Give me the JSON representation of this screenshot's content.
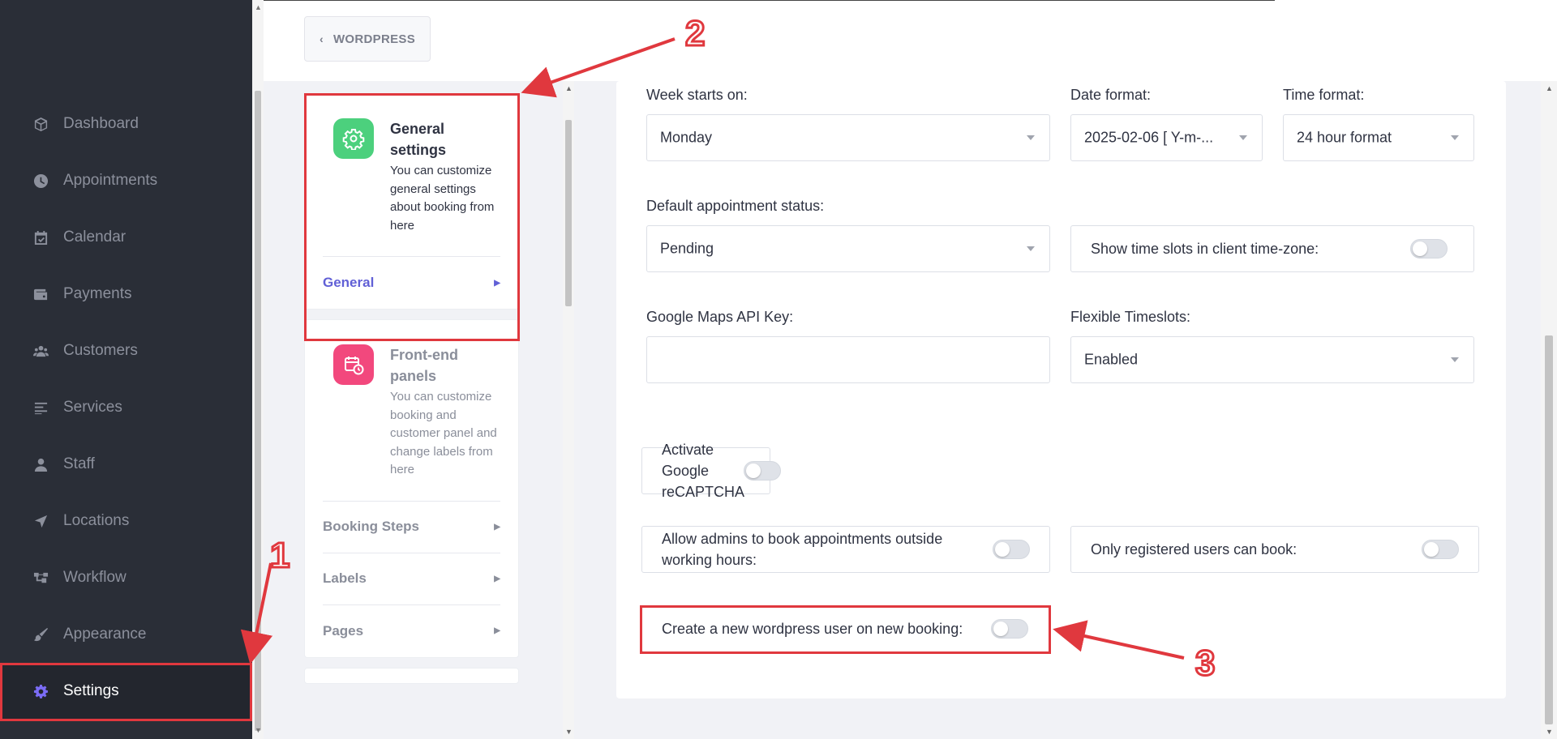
{
  "sidebar": {
    "items": [
      {
        "label": "Dashboard",
        "icon": "cube-icon"
      },
      {
        "label": "Appointments",
        "icon": "clock-icon"
      },
      {
        "label": "Calendar",
        "icon": "calendar-check-icon"
      },
      {
        "label": "Payments",
        "icon": "wallet-icon"
      },
      {
        "label": "Customers",
        "icon": "users-icon"
      },
      {
        "label": "Services",
        "icon": "list-icon"
      },
      {
        "label": "Staff",
        "icon": "user-icon"
      },
      {
        "label": "Locations",
        "icon": "location-arrow-icon"
      },
      {
        "label": "Workflow",
        "icon": "workflow-icon"
      },
      {
        "label": "Appearance",
        "icon": "brush-icon"
      },
      {
        "label": "Settings",
        "icon": "gear-icon",
        "active": true
      }
    ]
  },
  "header": {
    "back_label": "WORDPRESS"
  },
  "menu": {
    "general": {
      "title": "General settings",
      "desc": "You can customize general settings about booking from here",
      "links": [
        {
          "label": "General",
          "active": true
        }
      ]
    },
    "frontend": {
      "title": "Front-end panels",
      "desc": "You can customize booking and customer panel and change labels from here",
      "links": [
        {
          "label": "Booking Steps"
        },
        {
          "label": "Labels"
        },
        {
          "label": "Pages"
        }
      ]
    }
  },
  "form": {
    "week_starts": {
      "label": "Week starts on:",
      "value": "Monday"
    },
    "date_format": {
      "label": "Date format:",
      "value": "2025-02-06 [ Y-m-..."
    },
    "time_format": {
      "label": "Time format:",
      "value": "24 hour format"
    },
    "default_status": {
      "label": "Default appointment status:",
      "value": "Pending"
    },
    "client_tz": {
      "label": "Show time slots in client time-zone:",
      "on": false
    },
    "gmaps_key": {
      "label": "Google Maps API Key:",
      "value": ""
    },
    "flex_slots": {
      "label": "Flexible Timeslots:",
      "value": "Enabled"
    },
    "recaptcha": {
      "label": "Activate Google reCAPTCHA",
      "on": false
    },
    "admins_outside": {
      "label": "Allow admins to book appointments outside working hours:",
      "on": false
    },
    "only_registered": {
      "label": "Only registered users can book:",
      "on": false
    },
    "create_wp_user": {
      "label": "Create a new wordpress user on new booking:",
      "on": false
    }
  },
  "annotations": [
    "1",
    "2",
    "3"
  ],
  "colors": {
    "sidebar_bg": "#2a2e37",
    "accent": "#6160d6",
    "annotation_red": "#e0383e",
    "green_icon": "#4cd07d",
    "pink_icon": "#f2487d"
  }
}
